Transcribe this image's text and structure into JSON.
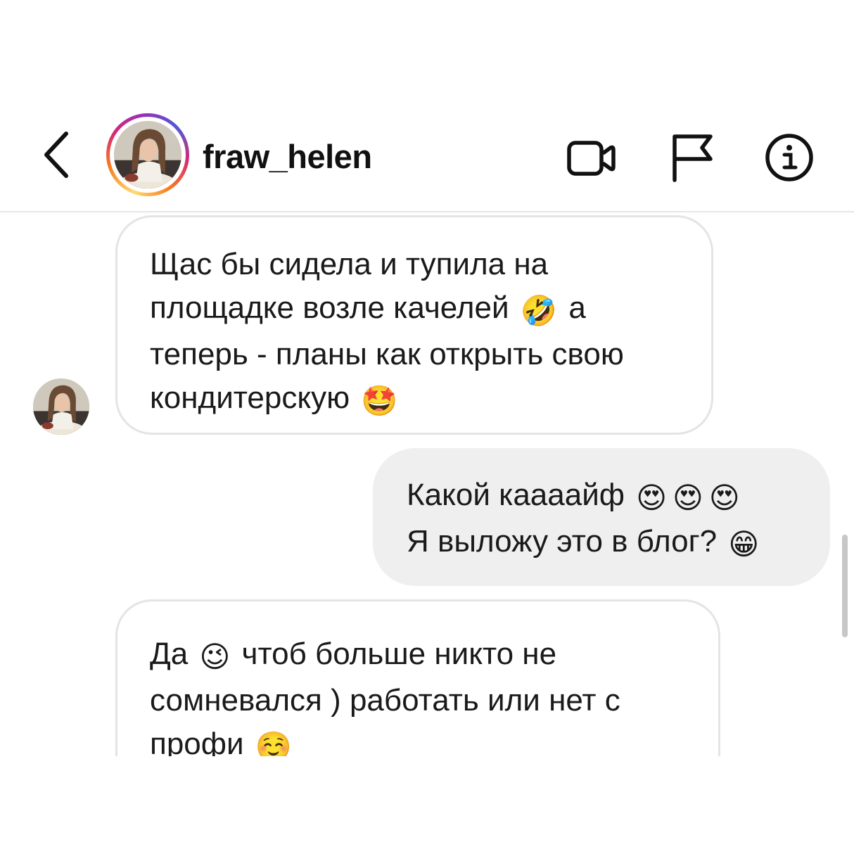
{
  "header": {
    "username": "fraw_helen",
    "icons": {
      "back": "chevron-left-icon",
      "video": "video-camera-icon",
      "flag": "flag-icon",
      "info": "info-icon"
    }
  },
  "messages": [
    {
      "direction": "incoming",
      "lines": [
        "Щас бы сидела и тупила на",
        "площадке возле качелей",
        "а",
        "теперь - планы как открыть свою",
        "кондитерскую"
      ],
      "emojis": [
        "🤣",
        "🤩"
      ]
    },
    {
      "direction": "outgoing",
      "lines": [
        "Какой каааайф",
        "Я выложу это в блог?"
      ],
      "emojis": [
        "😍",
        "😍",
        "😍",
        "😁"
      ]
    },
    {
      "direction": "incoming",
      "lines": [
        "Да",
        "чтоб больше никто не",
        "сомневался ) работать или нет с",
        "профи"
      ],
      "emojis": [
        "😉",
        "☺️"
      ]
    }
  ],
  "colors": {
    "incoming_border": "#e4e4e4",
    "outgoing_bg": "#efefef",
    "story_ring": [
      "#feda75",
      "#fa7e1e",
      "#d62976",
      "#962fbf",
      "#4f5bd5"
    ]
  }
}
